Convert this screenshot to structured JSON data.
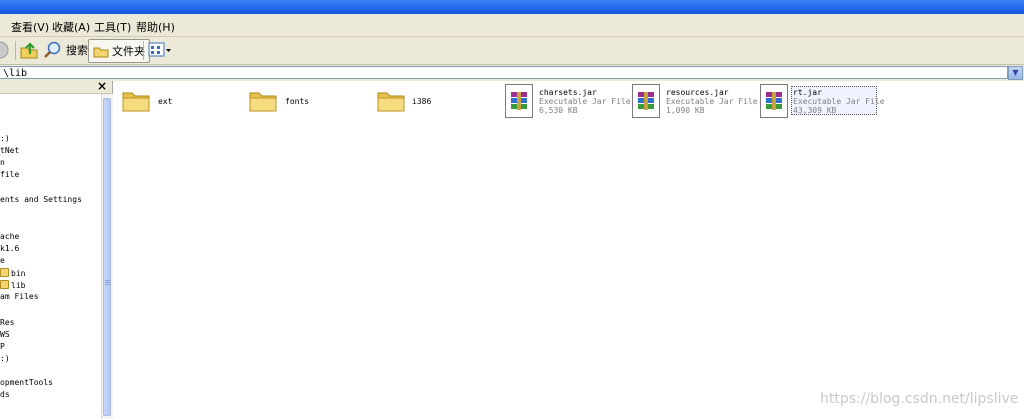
{
  "menu": {
    "view": "查看(V)",
    "favorites": "收藏(A)",
    "tools": "工具(T)",
    "help": "帮助(H)"
  },
  "toolbar": {
    "search": "搜索",
    "folders": "文件夹"
  },
  "address": {
    "value": "\\lib"
  },
  "tree": {
    "close": "×",
    "items": [
      ":)",
      "tNet",
      "n",
      "file",
      "ents and Settings",
      "ache",
      "k1.6",
      "e",
      "bin",
      "lib",
      "am Files",
      "Res",
      "WS",
      "P",
      ":)",
      "opmentTools",
      "ds"
    ]
  },
  "files": [
    {
      "name": "ext",
      "type": "folder"
    },
    {
      "name": "fonts",
      "type": "folder"
    },
    {
      "name": "i386",
      "type": "folder"
    },
    {
      "name": "charsets.jar",
      "desc": "Executable Jar File",
      "size": "6,530 KB",
      "type": "jar"
    },
    {
      "name": "resources.jar",
      "desc": "Executable Jar File",
      "size": "1,090 KB",
      "type": "jar"
    },
    {
      "name": "rt.jar",
      "desc": "Executable Jar File",
      "size": "43,309 KB",
      "type": "jar"
    }
  ],
  "watermark": "https://blog.csdn.net/lipslive",
  "colors": {
    "xp_blue": "#1457e3",
    "chrome": "#ece9d8",
    "accent": "#316ac5"
  }
}
